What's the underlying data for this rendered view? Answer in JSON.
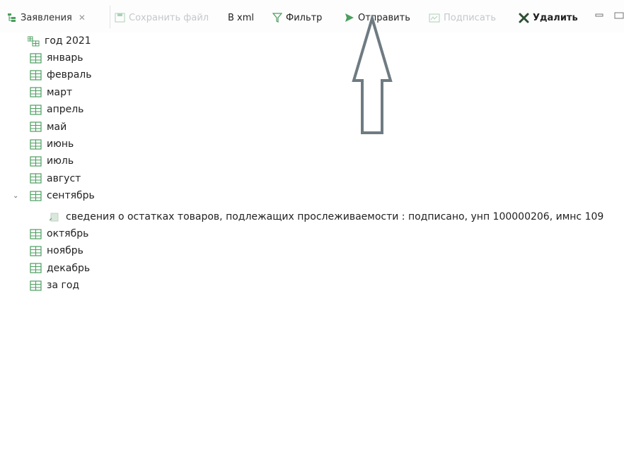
{
  "toolbar": {
    "tab_label": "Заявления",
    "tab_close": "✕",
    "save_file": "Сохранить файл",
    "to_xml": "В xml",
    "filter": "Фильтр",
    "send": "Отправить",
    "sign": "Подписать",
    "delete": "Удалить"
  },
  "tree": {
    "root": "год 2021",
    "months": [
      "январь",
      "февраль",
      "март",
      "апрель",
      "май",
      "июнь",
      "июль",
      "август",
      "сентябрь"
    ],
    "document": "сведения о остатках товаров, подлежащих прослеживаемости : подписано, унп 100000206, имнс 109",
    "months_after": [
      "октябрь",
      "ноябрь",
      "декабрь",
      "за год"
    ]
  },
  "colors": {
    "icon_green": "#4b9e5f",
    "arrow_gray": "#6f7b82"
  }
}
